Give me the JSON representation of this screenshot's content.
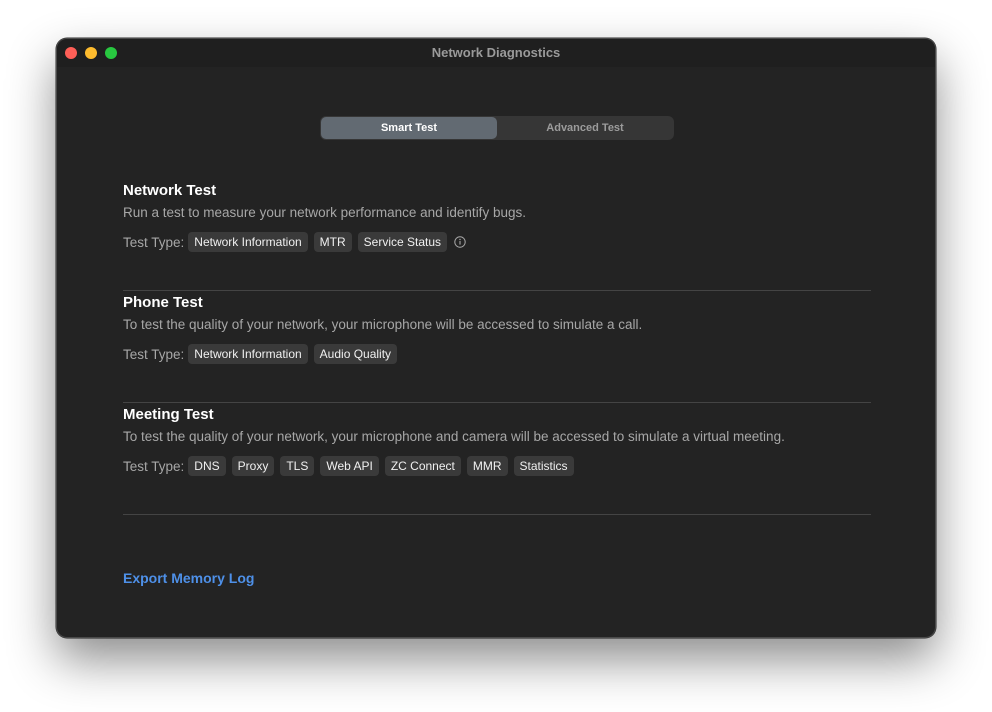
{
  "window": {
    "title": "Network Diagnostics"
  },
  "tabs": [
    {
      "label": "Smart Test",
      "active": true
    },
    {
      "label": "Advanced Test",
      "active": false
    }
  ],
  "sections": [
    {
      "title": "Network Test",
      "description": "Run a test to measure your network performance and identify bugs.",
      "type_label": "Test Type:",
      "types": [
        "Network Information",
        "MTR",
        "Service Status"
      ],
      "info_icon": "info-circle-icon"
    },
    {
      "title": "Phone Test",
      "description": "To test the quality of your network, your microphone will be accessed to simulate a call.",
      "type_label": "Test Type:",
      "types": [
        "Network Information",
        "Audio Quality"
      ]
    },
    {
      "title": "Meeting Test",
      "description": "To test the quality of your network, your microphone and camera will be accessed to simulate a virtual meeting.",
      "type_label": "Test Type:",
      "types": [
        "DNS",
        "Proxy",
        "TLS",
        "Web API",
        "ZC Connect",
        "MMR",
        "Statistics"
      ]
    }
  ],
  "export_link": "Export Memory Log",
  "colors": {
    "window_bg": "#232323",
    "accent_link": "#4e90e8",
    "active_tab": "#626a72",
    "close": "#fe5f57",
    "minimize": "#febc2e",
    "maximize": "#28c840"
  }
}
